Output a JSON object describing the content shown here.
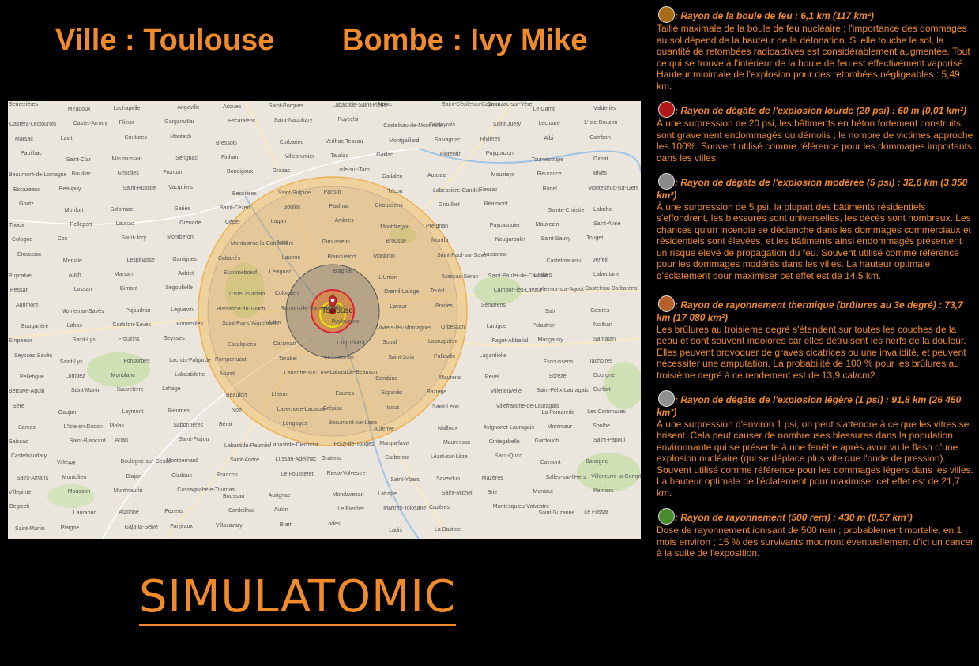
{
  "header": {
    "city": "Ville : Toulouse",
    "bomb": "Bombe : Ivy Mike"
  },
  "logo": "SIMULATOMIC",
  "map": {
    "center_city": "Toulouse",
    "places": [
      "Semezières",
      "Miradoux",
      "Lachapelle",
      "Angeville",
      "Asques",
      "Saint-Porquier",
      "Labastide-Saint-Pierre",
      "Nohic",
      "Saint-Cécile-du-Cayrou",
      "Cahuzac-sur-Vère",
      "Le Garric",
      "Valderiès",
      "Castéra-Lectourois",
      "Castet-Arrouy",
      "Plieux",
      "Garganvillar",
      "Escatalens",
      "Saint-Nauphary",
      "Puycelsi",
      "Castelnau-de-Montmiral",
      "Cestayrols",
      "Saint-Juéry",
      "Lectoure",
      "L'Isle-Bouzon",
      "Marsac",
      "Lavit",
      "Coutures",
      "Montech",
      "Bressols",
      "Corbarieu",
      "Verlhac-Tescou",
      "Montgaillard",
      "Salvagnac",
      "Rivières",
      "Albi",
      "Cambon",
      "Pauilhac",
      "Saint-Clar",
      "Maumusson",
      "Sérignac",
      "Finhan",
      "Villebrumier",
      "Tauriac",
      "Gaillac",
      "Florentin",
      "Puygouzon",
      "Tournecoupe",
      "Gimat",
      "Beaumont-de-Lomagne",
      "Bouillac",
      "Grisolles",
      "Fronton",
      "Bondigoux",
      "Grazac",
      "Lisle-sur-Tarn",
      "Cadalen",
      "Aussac",
      "Mouzieys",
      "Fleurance",
      "Bivès",
      "Escazeaux",
      "Beaupuy",
      "Saint-Rustice",
      "Vacquiers",
      "Bessières",
      "Saint-Sulpice",
      "Parisot",
      "Técou",
      "Labessière-Candeil",
      "Sieurac",
      "Ronel",
      "Montestruc-sur-Gers",
      "Goutz",
      "Monfort",
      "Solomiac",
      "Gariès",
      "Saint-Cézert",
      "Bouloc",
      "Paulhac",
      "Giroussens",
      "Graulhet",
      "Réalmont",
      "Sainte-Christie",
      "Labrihe",
      "Thoux",
      "Pelleport",
      "Launac",
      "Grenade",
      "Cépet",
      "Lugan",
      "Ambres",
      "Montdragon",
      "Preignan",
      "Puycasquier",
      "Mauvezin",
      "Saint-Anne",
      "Cologne",
      "Cox",
      "Saint-Jory",
      "Montberon",
      "Montastruc-la-Conseillère",
      "Azas",
      "Giroussens",
      "Brousse",
      "Montfa",
      "Nougaroulet",
      "Saint-Sauvy",
      "Touget",
      "Encausse",
      "Merville",
      "Lespinasse",
      "Garrigues",
      "Cabanès",
      "Lautrec",
      "Blanquefort",
      "Monbrun",
      "Saint-Paul-sur-Save",
      "Aussonne",
      "Castelmaurou",
      "Verfeil",
      "Puycalvel",
      "Auch",
      "Marsan",
      "Aubiet",
      "Escornebœuf",
      "Lévignac",
      "Blagnac",
      "L'Union",
      "Massac-Séran",
      "Saint-Paulet-de-Caisson",
      "Carbes",
      "Laboutarie",
      "Pessan",
      "Lussan",
      "Gimont",
      "Ségoufielle",
      "L'Isle-Jourdain",
      "Colomiers",
      "Toulouse",
      "Dremil-Lafage",
      "Teulat",
      "Cambon-lès-Lavaur",
      "Vielmur-sur-Agout",
      "Castelnau-Barbarens",
      "Aurimont",
      "Monferran-Savès",
      "Pujaudran",
      "Léguevin",
      "Plaisance-du-Touch",
      "Ramonville-Saint-Agne",
      "Vendine",
      "Lavaur",
      "Prades",
      "Sémalens",
      "Saïx",
      "Castres",
      "Bouganère",
      "Lahas",
      "Castillon-Savès",
      "Fontenilles",
      "Saint-Foy-d'Aigrefeuille",
      "Aurin",
      "Puylaurens",
      "Viviers-lès-Montagnes",
      "Orbessan",
      "Lartigue",
      "Polastron",
      "Noilhan",
      "Empeaux",
      "Saint-Lys",
      "Frouzins",
      "Seysses",
      "Escalquens",
      "Caraman",
      "Cuq-Toulza",
      "Soual",
      "Labruguière",
      "Faget-Abbatial",
      "Mongausy",
      "Samatan",
      "Seysses-Savès",
      "Saint-Lys",
      "Fonsorbes",
      "Lacroix-Falgarde",
      "Pompertuzat",
      "Tarabel",
      "Le Cabanial",
      "Saint-Julia",
      "Palleville",
      "Lagardiolle",
      "Escoussens",
      "Tachoires",
      "Pellefigue",
      "Lombez",
      "Monblanc",
      "Labastidette",
      "Muret",
      "Labarthe-sur-Lèze",
      "Labastide-Beauvoir",
      "Cambiac",
      "Maurens",
      "Revel",
      "Sorèze",
      "Dourgne",
      "Betcave-Aguin",
      "Saint-Martin",
      "Sauveterre",
      "Lahage",
      "Beaufort",
      "Lherm",
      "Eaunes",
      "Espanès",
      "Baziège",
      "Villenouvelle",
      "Saint-Félix-Lauragais",
      "Durfort",
      "Sère",
      "Gaujan",
      "Laymont",
      "Rieumes",
      "Noé",
      "Lavernose-Lacasse",
      "Grépiac",
      "Issus",
      "Saint-Léon",
      "Villefranche-de-Lauragais",
      "La Pomarède",
      "Les Cammazes",
      "Sarcos",
      "L'Isle-en-Dodon",
      "Molas",
      "Sabonnères",
      "Bérat",
      "Longages",
      "Beaumont-sur-Lèze",
      "Auterive",
      "Nailloux",
      "Avignonet-Lauragais",
      "Montmaur",
      "Soulhe",
      "Saissac",
      "Saint-Blancard",
      "Anan",
      "Saint-Frajou",
      "Labastide-Paumès",
      "Labastide-Clermont",
      "Pouy-de-Touges",
      "Marquefave",
      "Mauressac",
      "Cintegabelle",
      "Gardouch",
      "Saint-Papoul",
      "Castelnaudary",
      "Villespy",
      "Boulogne-sur-Gesse",
      "Montbernard",
      "Saint-André",
      "Lussan-Adeilhac",
      "Gratens",
      "Carbonne",
      "Lézat-sur-Lèze",
      "Saint-Quirc",
      "Calmont",
      "Baraigne",
      "Saint-Amans",
      "Montolieu",
      "Blajan",
      "Ciadoux",
      "Francon",
      "Le Fousseret",
      "Rieux-Volvestre",
      "Saint-Ybars",
      "Saverdun",
      "Mazères",
      "Salles-sur-l'Hers",
      "Villeneuve-la-Comptal",
      "Villepinte",
      "Mousson",
      "Montmaurin",
      "Cassagnabère-Tournas",
      "Boussan",
      "Aurignac",
      "Mondavezan",
      "Latrape",
      "Saint-Michel",
      "Brie",
      "Montaut",
      "Pamiers",
      "Belpech",
      "Laurabuc",
      "Alzonne",
      "Pezens",
      "Cardeilhac",
      "Aulon",
      "Le Fréchet",
      "Martres-Tolosane",
      "Cazères",
      "Montesquieu-Volvestre",
      "Saint-Suzanne",
      "Le Fossat",
      "Saint-Martin",
      "Plaigne",
      "Gaja-la-Selve",
      "Fanjeaux",
      "Villasavary",
      "Bram",
      "Lodes",
      "Ladis",
      "La Bastide"
    ]
  },
  "legend": [
    {
      "color": "#a86a14",
      "icon": "circle-icon",
      "title": ": Rayon de la boule de feu : 6,1 km (117 km²)",
      "desc": "Taille maximale de la boule de feu nucléaire ; l'importance des dommages au sol dépend de la hauteur de la détonation. Si elle touche le sol, la quantité de retombées radioactives est considérablement augmentée. Tout ce qui se trouve à l'intérieur de la boule de feu est effectivement vaporisé. Hauteur minimale de l'explosion pour des retombées négligeables : 5,49 km."
    },
    {
      "color": "#b01818",
      "icon": "circle-icon",
      "title": ": Rayon de dégâts de l'explosion lourde (20 psi) : 60 m (0,01 km²)",
      "desc": "À une surpression de 20 psi, les bâtiments en béton fortement construits sont gravement endommagés ou démolis ; le nombre de victimes approche les 100%. Souvent utilisé comme référence pour les dommages importants dans les villes."
    },
    {
      "color": "#8a8a8a",
      "icon": "circle-icon",
      "title": ": Rayon de dégâts de l'explosion modérée (5 psi) : 32,6 km (3 350 km²)",
      "desc": "À une surpression de 5 psi, la plupart des bâtiments résidentiels s'effondrent, les blessures sont universelles, les décès sont nombreux. Les chances qu'un incendie se déclenche dans les dommages commerciaux et résidentiels sont élevées, et les bâtiments ainsi endommagés présentent un risque élevé de propagation du feu. Souvent utilisé comme référence pour les dommages modérés dans les villes. La hauteur optimale d'éclatement pour maximiser cet effet est de 14,5 km."
    },
    {
      "color": "#b5602a",
      "icon": "circle-icon",
      "title": ": Rayon de rayonnement thermique (brûlures au 3e degré) : 73,7 km (17 080 km²)",
      "desc": "Les brûlures au troisième degré s'étendent sur toutes les couches de la peau et sont souvent indolores car elles détruisent les nerfs de la douleur. Elles peuvent provoquer de graves cicatrices ou une invalidité, et peuvent nécessiter une amputation. La probabilité de 100 % pour les brûlures au troisième degré à ce rendement est de 13,9 cal/cm2."
    },
    {
      "color": "#8f8f8f",
      "icon": "circle-icon",
      "title": ": Rayon de dégâts de l'explosion légère (1 psi) : 91,8 km (26 450 km²)",
      "desc": "À une surpression d'environ 1 psi, on peut s'attendre à ce que les vitres se brisent. Cela peut causer de nombreuses blessures dans la population environnante qui se présente à une fenêtre après avoir vu le flash d'une explosion nucléaire (qui se déplace plus vite que l'onde de pression). Souvent utilisé comme référence pour les dommages légers dans les villes. La hauteur optimale de l'éclatement pour maximiser cet effet est de 21,7 km."
    },
    {
      "color": "#4a8a2e",
      "icon": "circle-icon",
      "title": ": Rayon de rayonnement (500 rem) : 430 m (0,57 km²)",
      "desc": "Dose de rayonnement ionisant de 500 rem ; probablement mortelle, en 1 mois environ ; 15 % des survivants mourront éventuellement d'ici un cancer à la suite de l'exposition."
    }
  ]
}
